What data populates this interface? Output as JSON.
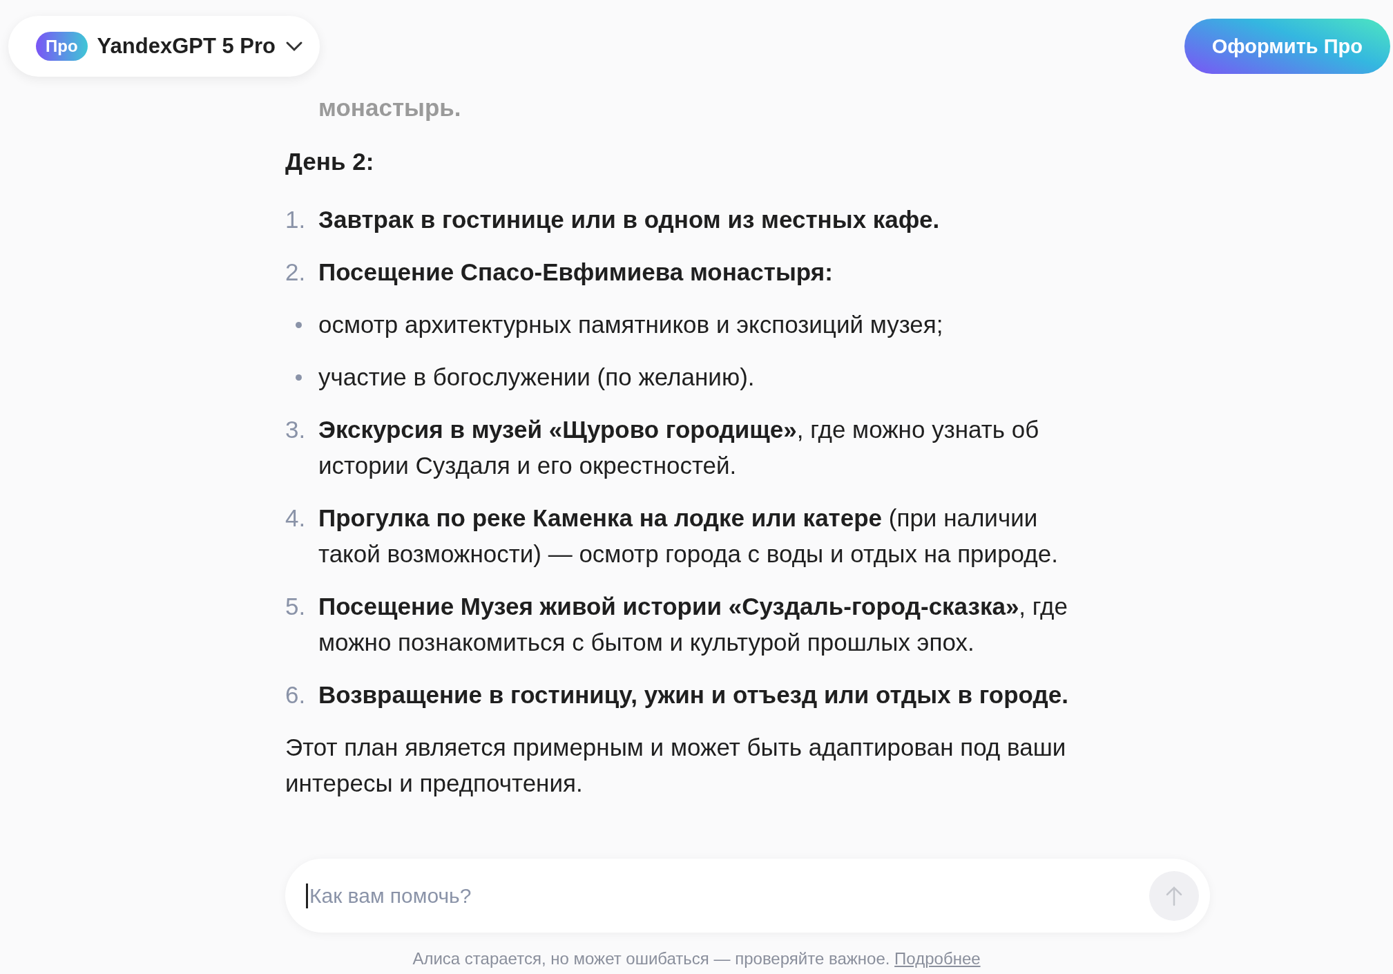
{
  "header": {
    "badge": "Про",
    "model": "YandexGPT 5 Pro",
    "cta": "Оформить Про"
  },
  "chat": {
    "faded_line": "монастырь.",
    "heading": "День 2:",
    "items": [
      {
        "kind": "numbered",
        "marker": "1.",
        "text": "**Завтрак в гостинице или в одном из местных кафе.**"
      },
      {
        "kind": "numbered",
        "marker": "2.",
        "text": "**Посещение Спасо-Евфимиева монастыря:**"
      },
      {
        "kind": "bullet",
        "text": "осмотр архитектурных памятников и экспозиций музея;"
      },
      {
        "kind": "bullet",
        "text": "участие в богослужении (по желанию)."
      },
      {
        "kind": "numbered",
        "marker": "3.",
        "text": "**Экскурсия в музей «Щурово городище»**, где можно узнать об истории Суздаля и его окрестностей."
      },
      {
        "kind": "numbered",
        "marker": "4.",
        "text": "**Прогулка по реке Каменка на лодке или катере** (при наличии такой возможности) — осмотр города с воды и отдых на природе."
      },
      {
        "kind": "numbered",
        "marker": "5.",
        "text": "**Посещение Музея живой истории «Суздаль-город-сказка»**, где можно познакомиться с бытом и культурой прошлых эпох."
      },
      {
        "kind": "numbered",
        "marker": "6.",
        "text": "**Возвращение в гостиницу, ужин и отъезд или отдых в городе.**"
      }
    ],
    "closing": "Этот план является примерным и может быть адаптирован под ваши интересы и предпочтения."
  },
  "composer": {
    "placeholder": "Как вам помочь?"
  },
  "footer": {
    "note": "Алиса старается, но может ошибаться — проверяйте важное.",
    "link": "Подробнее"
  }
}
